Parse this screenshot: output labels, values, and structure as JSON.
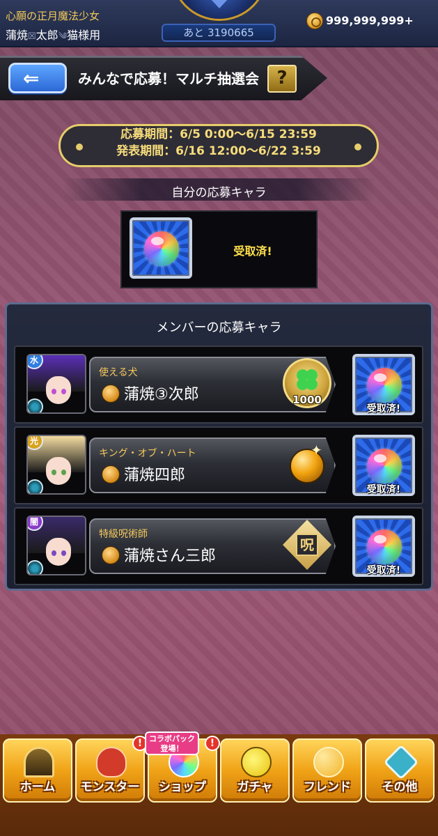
{
  "header": {
    "title": "心願の正月魔法少女",
    "player_name": "蒲焼",
    "player_name_mid": "太郎",
    "player_name_suffix": "猫様用",
    "remaining": "あと 3190665",
    "coin_amount": "999,999,999+"
  },
  "page": {
    "back_label": "⇐",
    "title": "みんなで応募！マルチ抽選会",
    "help_label": "?"
  },
  "period": {
    "entry": "応募期間：6/5 0:00〜6/15 23:59",
    "announce": "発表期間：6/16 12:00〜6/22 3:59"
  },
  "own_entry": {
    "heading": "自分の応募キャラ",
    "status": "受取済!"
  },
  "members": {
    "heading": "メンバーの応募キャラ",
    "rows": [
      {
        "title": "使える犬",
        "name": "蒲焼③次郎",
        "element": "水",
        "badge": "clover-icon",
        "badge_value": "1000",
        "status": "受取済!",
        "hair_color": "#5b2fb8",
        "eye_color": "#c04fd8",
        "element_color": "#2f7ee0"
      },
      {
        "title": "キング・オブ・ハート",
        "name": "蒲焼四郎",
        "element": "光",
        "badge": "gold-sphere-icon",
        "status": "受取済!",
        "hair_color": "#f4dca0",
        "eye_color": "#5ba24a",
        "element_color": "#d8a320"
      },
      {
        "title": "特級呪術師",
        "name": "蒲焼さん三郎",
        "element": "闇",
        "badge": "seal-icon",
        "badge_glyph": "呪",
        "status": "受取済!",
        "hair_color": "#3a2a6a",
        "eye_color": "#7a4ac0",
        "element_color": "#8a3ac8"
      }
    ]
  },
  "nav": {
    "home": "ホーム",
    "monster": "モンスター",
    "shop": "ショップ",
    "gacha": "ガチャ",
    "friend": "フレンド",
    "other": "その他",
    "collab_tag": "コラボパック登場！",
    "alert": "!"
  }
}
